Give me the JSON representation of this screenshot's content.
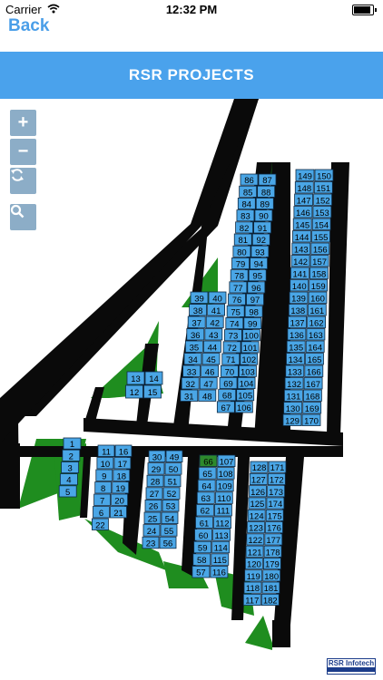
{
  "status_bar": {
    "carrier": "Carrier",
    "time": "12:32 PM",
    "battery_percent": 90
  },
  "nav": {
    "back_label": "Back",
    "title": "RSR PROJECTS"
  },
  "map_controls": {
    "zoom_in": "+",
    "zoom_out": "−"
  },
  "watermark": "RSR Infotech",
  "colors": {
    "plot": "#4aa6e6",
    "plot_highlight": "#2d8a2d",
    "road": "#0a0a0a",
    "green": "#1f8d1f",
    "header": "#4aa2ec",
    "link": "#4a9ee8"
  },
  "plots": [
    {
      "label": "86"
    },
    {
      "label": "87"
    },
    {
      "label": "85"
    },
    {
      "label": "88"
    },
    {
      "label": "84"
    },
    {
      "label": "89"
    },
    {
      "label": "83"
    },
    {
      "label": "90"
    },
    {
      "label": "82"
    },
    {
      "label": "91"
    },
    {
      "label": "81"
    },
    {
      "label": "92"
    },
    {
      "label": "80"
    },
    {
      "label": "93"
    },
    {
      "label": "79"
    },
    {
      "label": "94"
    },
    {
      "label": "78"
    },
    {
      "label": "95"
    },
    {
      "label": "77"
    },
    {
      "label": "96"
    },
    {
      "label": "76"
    },
    {
      "label": "97"
    },
    {
      "label": "75"
    },
    {
      "label": "98"
    },
    {
      "label": "74"
    },
    {
      "label": "99"
    },
    {
      "label": "73"
    },
    {
      "label": "100"
    },
    {
      "label": "72"
    },
    {
      "label": "101"
    },
    {
      "label": "71"
    },
    {
      "label": "102"
    },
    {
      "label": "70"
    },
    {
      "label": "103"
    },
    {
      "label": "69"
    },
    {
      "label": "104"
    },
    {
      "label": "68"
    },
    {
      "label": "105"
    },
    {
      "label": "67"
    },
    {
      "label": "106"
    },
    {
      "label": "149"
    },
    {
      "label": "150"
    },
    {
      "label": "148"
    },
    {
      "label": "151"
    },
    {
      "label": "147"
    },
    {
      "label": "152"
    },
    {
      "label": "146"
    },
    {
      "label": "153"
    },
    {
      "label": "145"
    },
    {
      "label": "154"
    },
    {
      "label": "144"
    },
    {
      "label": "155"
    },
    {
      "label": "143"
    },
    {
      "label": "156"
    },
    {
      "label": "142"
    },
    {
      "label": "157"
    },
    {
      "label": "141"
    },
    {
      "label": "158"
    },
    {
      "label": "140"
    },
    {
      "label": "159"
    },
    {
      "label": "139"
    },
    {
      "label": "160"
    },
    {
      "label": "138"
    },
    {
      "label": "161"
    },
    {
      "label": "137"
    },
    {
      "label": "162"
    },
    {
      "label": "136"
    },
    {
      "label": "163"
    },
    {
      "label": "135"
    },
    {
      "label": "164"
    },
    {
      "label": "134"
    },
    {
      "label": "165"
    },
    {
      "label": "133"
    },
    {
      "label": "166"
    },
    {
      "label": "132"
    },
    {
      "label": "167"
    },
    {
      "label": "131"
    },
    {
      "label": "168"
    },
    {
      "label": "130"
    },
    {
      "label": "169"
    },
    {
      "label": "129"
    },
    {
      "label": "170"
    },
    {
      "label": "39"
    },
    {
      "label": "40"
    },
    {
      "label": "38"
    },
    {
      "label": "41"
    },
    {
      "label": "37"
    },
    {
      "label": "42"
    },
    {
      "label": "36"
    },
    {
      "label": "43"
    },
    {
      "label": "35"
    },
    {
      "label": "44"
    },
    {
      "label": "34"
    },
    {
      "label": "45"
    },
    {
      "label": "33"
    },
    {
      "label": "46"
    },
    {
      "label": "32"
    },
    {
      "label": "47"
    },
    {
      "label": "31"
    },
    {
      "label": "48"
    },
    {
      "label": "13"
    },
    {
      "label": "14"
    },
    {
      "label": "12"
    },
    {
      "label": "15"
    },
    {
      "label": "1"
    },
    {
      "label": "2"
    },
    {
      "label": "3"
    },
    {
      "label": "4"
    },
    {
      "label": "5"
    },
    {
      "label": "11"
    },
    {
      "label": "16"
    },
    {
      "label": "10"
    },
    {
      "label": "17"
    },
    {
      "label": "9"
    },
    {
      "label": "18"
    },
    {
      "label": "8"
    },
    {
      "label": "19"
    },
    {
      "label": "7"
    },
    {
      "label": "20"
    },
    {
      "label": "6"
    },
    {
      "label": "21"
    },
    {
      "label": "22"
    },
    {
      "label": "30"
    },
    {
      "label": "49"
    },
    {
      "label": "29"
    },
    {
      "label": "50"
    },
    {
      "label": "28"
    },
    {
      "label": "51"
    },
    {
      "label": "27"
    },
    {
      "label": "52"
    },
    {
      "label": "26"
    },
    {
      "label": "53"
    },
    {
      "label": "25"
    },
    {
      "label": "54"
    },
    {
      "label": "24"
    },
    {
      "label": "55"
    },
    {
      "label": "23"
    },
    {
      "label": "56"
    },
    {
      "label": "66",
      "highlight": true
    },
    {
      "label": "107"
    },
    {
      "label": "65"
    },
    {
      "label": "108"
    },
    {
      "label": "64"
    },
    {
      "label": "109"
    },
    {
      "label": "63"
    },
    {
      "label": "110"
    },
    {
      "label": "62"
    },
    {
      "label": "111"
    },
    {
      "label": "61"
    },
    {
      "label": "112"
    },
    {
      "label": "60"
    },
    {
      "label": "113"
    },
    {
      "label": "59"
    },
    {
      "label": "114"
    },
    {
      "label": "58"
    },
    {
      "label": "115"
    },
    {
      "label": "57"
    },
    {
      "label": "116"
    },
    {
      "label": "128"
    },
    {
      "label": "171"
    },
    {
      "label": "127"
    },
    {
      "label": "172"
    },
    {
      "label": "126"
    },
    {
      "label": "173"
    },
    {
      "label": "125"
    },
    {
      "label": "174"
    },
    {
      "label": "124"
    },
    {
      "label": "175"
    },
    {
      "label": "123"
    },
    {
      "label": "176"
    },
    {
      "label": "122"
    },
    {
      "label": "177"
    },
    {
      "label": "121"
    },
    {
      "label": "178"
    },
    {
      "label": "120"
    },
    {
      "label": "179"
    },
    {
      "label": "119"
    },
    {
      "label": "180"
    },
    {
      "label": "118"
    },
    {
      "label": "181"
    },
    {
      "label": "117"
    },
    {
      "label": "182"
    }
  ]
}
